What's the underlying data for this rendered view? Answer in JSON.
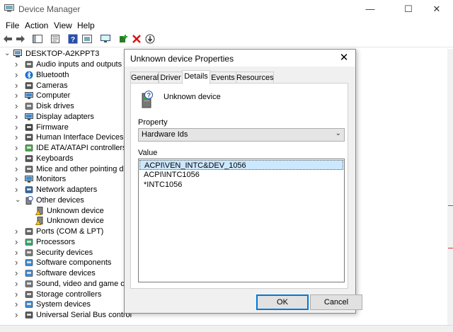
{
  "window": {
    "title": "Device Manager",
    "controls": [
      "minimize",
      "maximize",
      "close"
    ]
  },
  "menu": [
    "File",
    "Action",
    "View",
    "Help"
  ],
  "toolbar": [
    "back-icon",
    "forward-icon",
    "console-tree-icon",
    "properties-icon",
    "help-icon",
    "update-driver-icon",
    "scan-hardware-icon",
    "add-legacy-icon",
    "uninstall-icon",
    "disable-icon"
  ],
  "tree": {
    "root": "DESKTOP-A2KPPT3",
    "items": [
      {
        "label": "Audio inputs and outputs",
        "icon": "speaker-icon",
        "expanded": false
      },
      {
        "label": "Bluetooth",
        "icon": "bluetooth-icon",
        "expanded": false
      },
      {
        "label": "Cameras",
        "icon": "camera-icon",
        "expanded": false
      },
      {
        "label": "Computer",
        "icon": "computer-icon",
        "expanded": false
      },
      {
        "label": "Disk drives",
        "icon": "disk-icon",
        "expanded": false
      },
      {
        "label": "Display adapters",
        "icon": "display-icon",
        "expanded": false
      },
      {
        "label": "Firmware",
        "icon": "firmware-icon",
        "expanded": false
      },
      {
        "label": "Human Interface Devices",
        "icon": "hid-icon",
        "expanded": false
      },
      {
        "label": "IDE ATA/ATAPI controllers",
        "icon": "ide-icon",
        "expanded": false
      },
      {
        "label": "Keyboards",
        "icon": "keyboard-icon",
        "expanded": false
      },
      {
        "label": "Mice and other pointing devi",
        "icon": "mouse-icon",
        "expanded": false
      },
      {
        "label": "Monitors",
        "icon": "monitor-icon",
        "expanded": false
      },
      {
        "label": "Network adapters",
        "icon": "network-icon",
        "expanded": false
      },
      {
        "label": "Other devices",
        "icon": "unknown-device-icon",
        "expanded": true
      },
      {
        "label": "Unknown device",
        "icon": "warning-device-icon",
        "child": true
      },
      {
        "label": "Unknown device",
        "icon": "warning-device-icon",
        "child": true
      },
      {
        "label": "Ports (COM & LPT)",
        "icon": "port-icon",
        "expanded": false
      },
      {
        "label": "Processors",
        "icon": "cpu-icon",
        "expanded": false
      },
      {
        "label": "Security devices",
        "icon": "security-icon",
        "expanded": false
      },
      {
        "label": "Software components",
        "icon": "software-icon",
        "expanded": false
      },
      {
        "label": "Software devices",
        "icon": "software-icon",
        "expanded": false
      },
      {
        "label": "Sound, video and game cont",
        "icon": "sound-icon",
        "expanded": false
      },
      {
        "label": "Storage controllers",
        "icon": "storage-icon",
        "expanded": false
      },
      {
        "label": "System devices",
        "icon": "system-icon",
        "expanded": false
      },
      {
        "label": "Universal Serial Bus controllers",
        "icon": "usb-icon",
        "expanded": false
      }
    ]
  },
  "dialog": {
    "title": "Unknown device Properties",
    "tabs": [
      "General",
      "Driver",
      "Details",
      "Events",
      "Resources"
    ],
    "active_tab": "Details",
    "device_name": "Unknown device",
    "property_label": "Property",
    "property_value": "Hardware Ids",
    "value_label": "Value",
    "values": [
      "ACPI\\VEN_INTC&DEV_1056",
      "ACPI\\INTC1056",
      "*INTC1056"
    ],
    "selected_value_index": 0,
    "ok_label": "OK",
    "cancel_label": "Cancel"
  },
  "colors": {
    "selection": "#cce8ff",
    "accent": "#0078d7",
    "dialog_bg": "#f0f0f0"
  }
}
